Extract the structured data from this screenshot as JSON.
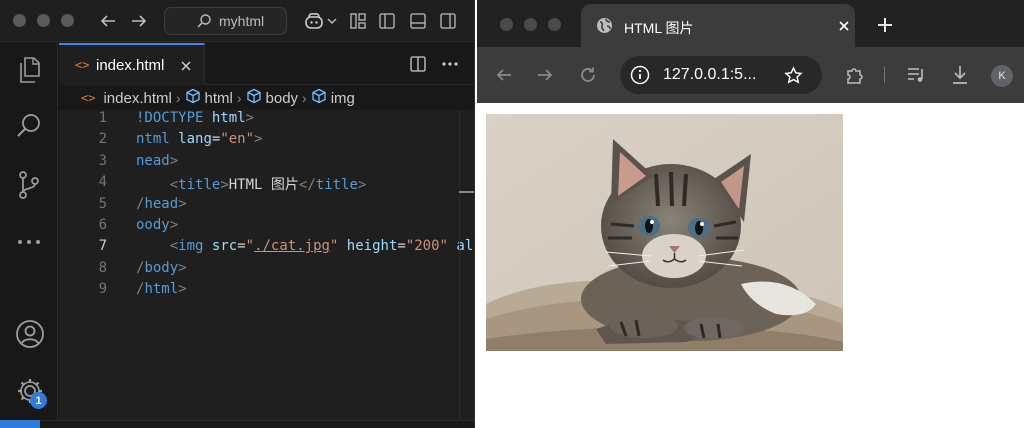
{
  "vscode": {
    "command_center": {
      "text": "myhtml"
    },
    "tab": {
      "label": "index.html",
      "icon": "code-brackets-icon"
    },
    "breadcrumb": [
      "index.html",
      "html",
      "body",
      "img"
    ],
    "settings_badge": "1",
    "code_lines": [
      {
        "n": "1",
        "tokens": [
          [
            "t-tag",
            "!DOCTYPE"
          ],
          [
            "t-text",
            " "
          ],
          [
            "t-attr",
            "html"
          ],
          [
            "t-punct",
            ">"
          ]
        ]
      },
      {
        "n": "2",
        "tokens": [
          [
            "t-tag",
            "ntml"
          ],
          [
            "t-text",
            " "
          ],
          [
            "t-attr",
            "lang"
          ],
          [
            "t-text",
            "="
          ],
          [
            "t-str",
            "\"en\""
          ],
          [
            "t-punct",
            ">"
          ]
        ]
      },
      {
        "n": "3",
        "tokens": [
          [
            "t-tag",
            "nead"
          ],
          [
            "t-punct",
            ">"
          ]
        ]
      },
      {
        "n": "4",
        "tokens": [
          [
            "t-text",
            "    "
          ],
          [
            "t-punct",
            "<"
          ],
          [
            "t-tag",
            "title"
          ],
          [
            "t-punct",
            ">"
          ],
          [
            "t-text",
            "HTML 图片"
          ],
          [
            "t-punct",
            "</"
          ],
          [
            "t-tag",
            "title"
          ],
          [
            "t-punct",
            ">"
          ]
        ]
      },
      {
        "n": "5",
        "tokens": [
          [
            "t-punct",
            "/"
          ],
          [
            "t-tag",
            "head"
          ],
          [
            "t-punct",
            ">"
          ]
        ]
      },
      {
        "n": "6",
        "tokens": [
          [
            "t-tag",
            "oody"
          ],
          [
            "t-punct",
            ">"
          ]
        ]
      },
      {
        "n": "7",
        "tokens": [
          [
            "t-text",
            "    "
          ],
          [
            "t-punct",
            "<"
          ],
          [
            "t-tag",
            "img"
          ],
          [
            "t-text",
            " "
          ],
          [
            "t-attr",
            "src"
          ],
          [
            "t-text",
            "="
          ],
          [
            "t-str",
            "\""
          ],
          [
            "t-link",
            "./cat.jpg"
          ],
          [
            "t-str",
            "\""
          ],
          [
            "t-text",
            " "
          ],
          [
            "t-attr",
            "height"
          ],
          [
            "t-text",
            "="
          ],
          [
            "t-str",
            "\"200\""
          ],
          [
            "t-text",
            " "
          ],
          [
            "t-attr",
            "alt"
          ]
        ]
      },
      {
        "n": "8",
        "tokens": [
          [
            "t-punct",
            "/"
          ],
          [
            "t-tag",
            "body"
          ],
          [
            "t-punct",
            ">"
          ]
        ]
      },
      {
        "n": "9",
        "tokens": [
          [
            "t-punct",
            "/"
          ],
          [
            "t-tag",
            "html"
          ],
          [
            "t-punct",
            ">"
          ]
        ]
      }
    ],
    "active_line": "7"
  },
  "browser": {
    "tab_title": "HTML 图片",
    "url": "127.0.0.1:5...",
    "profile_initial": "K",
    "page_image": {
      "icon": "cat-photo"
    }
  },
  "colors": {
    "accent": "#3b82f6",
    "vscode_bg": "#1f1f1f",
    "browser_frame": "#3c3c3c"
  }
}
